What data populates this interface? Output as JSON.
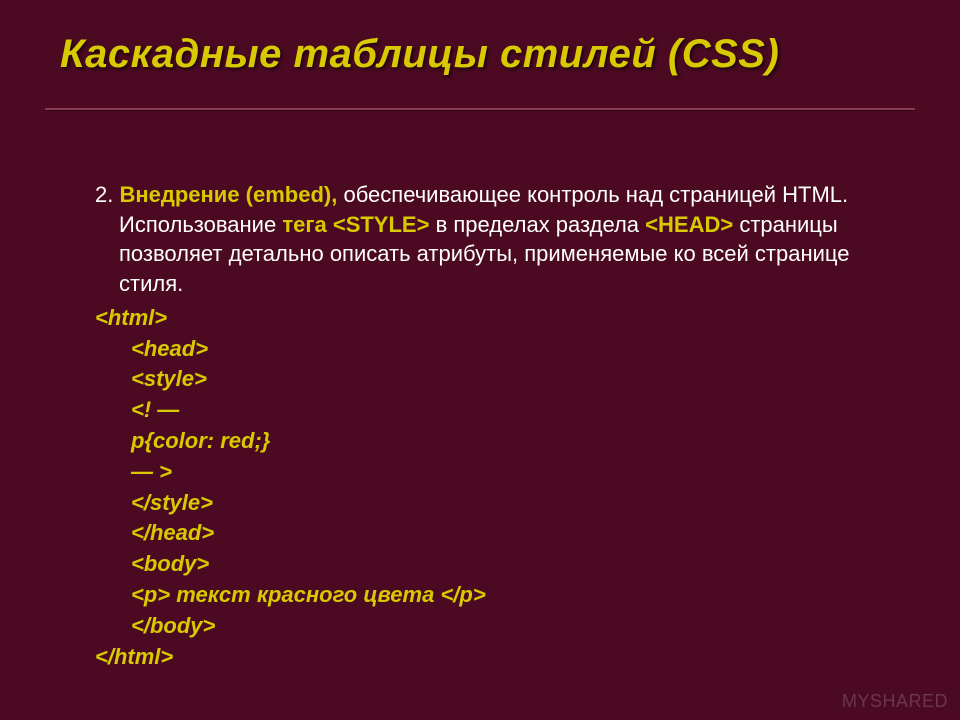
{
  "title": "Каскадные таблицы стилей (CSS)",
  "para": {
    "num": "2. ",
    "lead": "Внедрение (embed),",
    "t1": " обеспечивающее контроль над страницей HTML. Использование ",
    "kw1": "тега <STYLE>",
    "t2": " в пределах раздела ",
    "kw2": "<HEAD>",
    "t3": " страницы позволяет детально описать атрибуты, применяемые ко всей странице стиля."
  },
  "code": {
    "l1": "<html>",
    "l2": "<head>",
    "l3": "<style>",
    "l4": "<! —",
    "l5": "p{color: red;}",
    "l6": "— >",
    "l7": "</style>",
    "l8": "</head>",
    "l9": "<body>",
    "l10a": "<p> ",
    "l10b": "текст красного цвета",
    "l10c": " </p>",
    "l11": "</body>",
    "l12": "</html>"
  },
  "watermark": "MYSHARED"
}
